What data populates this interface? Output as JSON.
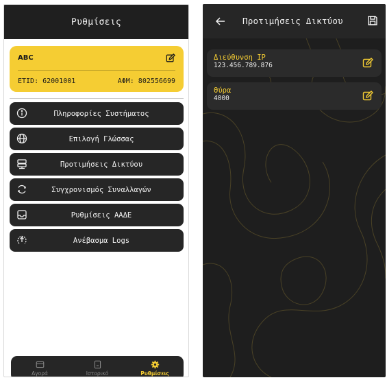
{
  "settings_screen": {
    "title": "Ρυθμίσεις",
    "card": {
      "name": "ABC",
      "etid": "ETID: 62001001",
      "afm": "ΑΦΜ: 802556699",
      "edit_icon": "edit-icon"
    },
    "menu": [
      {
        "label": "Πληροφορίες Συστήματος",
        "icon": "info-icon"
      },
      {
        "label": "Επιλογή Γλώσσας",
        "icon": "globe-icon"
      },
      {
        "label": "Προτιμήσεις Δικτύου",
        "icon": "server-icon"
      },
      {
        "label": "Συγχρονισμός Συναλλαγών",
        "icon": "sync-icon"
      },
      {
        "label": "Ρυθμίσεις ΑΑΔΕ",
        "icon": "inbox-icon"
      },
      {
        "label": "Ανέβασμα Logs",
        "icon": "upload-icon"
      }
    ],
    "nav": [
      {
        "label": "Αγορά",
        "icon": "card-icon",
        "active": false
      },
      {
        "label": "Ιστορικό",
        "icon": "receipt-icon",
        "active": false
      },
      {
        "label": "Ρυθμίσεις",
        "icon": "gear-icon",
        "active": true
      }
    ]
  },
  "network_screen": {
    "title": "Προτιμήσεις Δικτύου",
    "fields": [
      {
        "label": "Διεύθυνση IP",
        "value": "123.456.789.876"
      },
      {
        "label": "Θύρα",
        "value": "4000"
      }
    ]
  },
  "colors": {
    "accent": "#f5cd33",
    "dark": "#262626",
    "background_dark": "#1e1e1e"
  }
}
